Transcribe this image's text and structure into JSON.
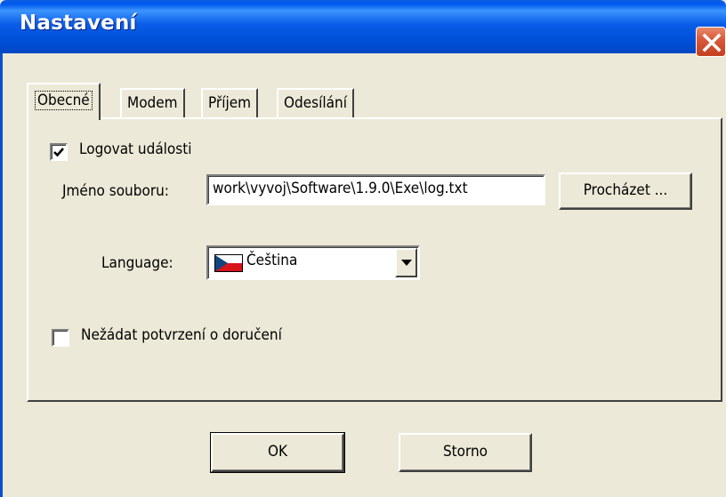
{
  "window": {
    "title": "Nastavení",
    "close_icon": "close-icon"
  },
  "tabs": [
    {
      "label": "Obecné",
      "active": true
    },
    {
      "label": "Modem",
      "active": false
    },
    {
      "label": "Příjem",
      "active": false
    },
    {
      "label": "Odesílání",
      "active": false
    }
  ],
  "general": {
    "log_events": {
      "label": "Logovat události",
      "checked": true
    },
    "file_name": {
      "label": "Jméno souboru:",
      "value": "work\\vyvoj\\Software\\1.9.0\\Exe\\log.txt"
    },
    "browse_label": "Procházet ...",
    "language": {
      "label": "Language:",
      "selected": "Čeština",
      "flag_icon": "czech-flag-icon"
    },
    "no_delivery_receipt": {
      "label": "Nežádat potvrzení o doručení",
      "checked": false
    }
  },
  "footer": {
    "ok_label": "OK",
    "cancel_label": "Storno"
  },
  "colors": {
    "title_bar": "#0058ee",
    "dialog_bg": "#ece9d8",
    "close_button": "#d95a3b"
  }
}
